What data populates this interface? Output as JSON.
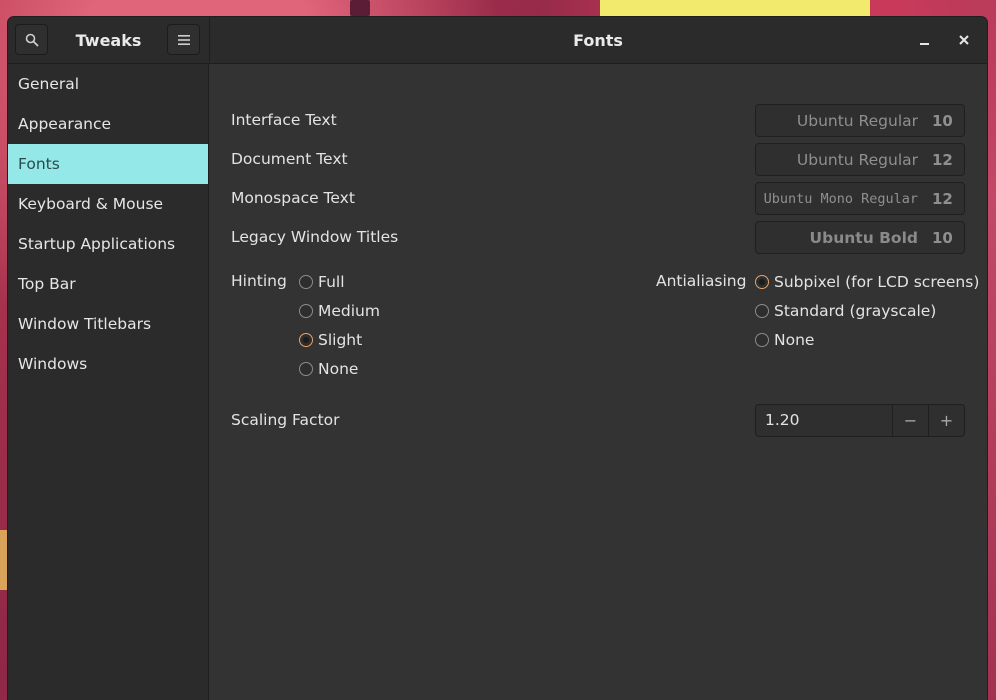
{
  "app": {
    "sidebar_title": "Tweaks",
    "page_title": "Fonts"
  },
  "sidebar": {
    "items": [
      {
        "label": "General"
      },
      {
        "label": "Appearance"
      },
      {
        "label": "Fonts",
        "selected": true
      },
      {
        "label": "Keyboard & Mouse"
      },
      {
        "label": "Startup Applications"
      },
      {
        "label": "Top Bar"
      },
      {
        "label": "Window Titlebars"
      },
      {
        "label": "Windows"
      }
    ]
  },
  "fonts": {
    "interface": {
      "label": "Interface Text",
      "font": "Ubuntu Regular",
      "size": "10"
    },
    "document": {
      "label": "Document Text",
      "font": "Ubuntu Regular",
      "size": "12"
    },
    "monospace": {
      "label": "Monospace Text",
      "font": "Ubuntu Mono Regular",
      "size": "12"
    },
    "legacy": {
      "label": "Legacy Window Titles",
      "font": "Ubuntu Bold",
      "size": "10"
    }
  },
  "hinting": {
    "label": "Hinting",
    "options": [
      "Full",
      "Medium",
      "Slight",
      "None"
    ],
    "selected": "Slight"
  },
  "antialiasing": {
    "label": "Antialiasing",
    "options": [
      "Subpixel (for LCD screens)",
      "Standard (grayscale)",
      "None"
    ],
    "selected": "Subpixel (for LCD screens)"
  },
  "scaling": {
    "label": "Scaling Factor",
    "value": "1.20",
    "decrement": "−",
    "increment": "+"
  },
  "colors": {
    "selected_bg": "#94e8e8",
    "radio_accent": "#e5a36a",
    "window_bg": "#333333"
  }
}
